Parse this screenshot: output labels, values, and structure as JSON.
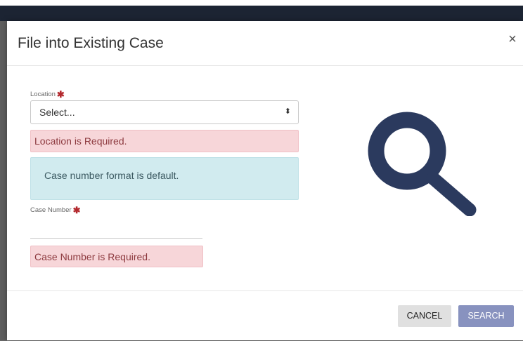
{
  "modal": {
    "title": "File into Existing Case",
    "close_glyph": "×"
  },
  "form": {
    "location": {
      "label": "Location",
      "required_marker": "✱",
      "selected_value": "Select...",
      "caret_glyph": "⬍",
      "error": "Location is Required."
    },
    "info_message": "Case number format is default.",
    "case_number": {
      "label": "Case Number",
      "required_marker": "✱",
      "value": "",
      "error": "Case Number is Required."
    }
  },
  "illustration": {
    "icon": "search-icon",
    "color": "#2b3a5e"
  },
  "footer": {
    "cancel_label": "CANCEL",
    "search_label": "SEARCH"
  },
  "colors": {
    "error_bg": "#f7d6d9",
    "info_bg": "#d1ebef",
    "primary_button": "#8892bf",
    "required_star": "#b3282d"
  }
}
